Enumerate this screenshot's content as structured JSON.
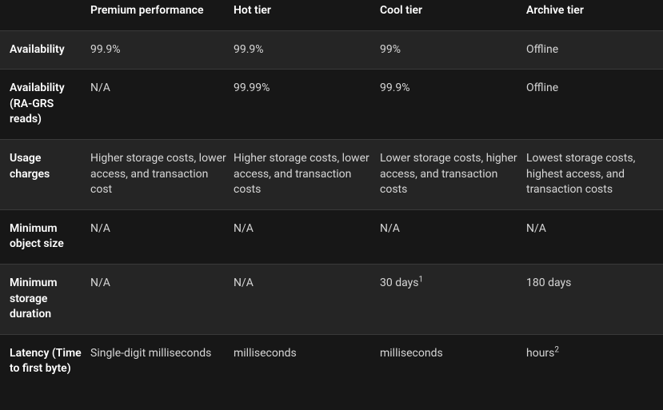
{
  "headers": {
    "label": "",
    "premium": "Premium performance",
    "hot": "Hot tier",
    "cool": "Cool tier",
    "archive": "Archive tier"
  },
  "rows": {
    "availability": {
      "label": "Availability",
      "premium": "99.9%",
      "hot": "99.9%",
      "cool": "99%",
      "archive": "Offline"
    },
    "availability_ragrs": {
      "label": "Availability (RA-GRS reads)",
      "premium": "N/A",
      "hot": "99.99%",
      "cool": "99.9%",
      "archive": "Offline"
    },
    "usage_charges": {
      "label": "Usage charges",
      "premium": "Higher storage costs, lower access, and transaction cost",
      "hot": "Higher storage costs, lower access, and transaction costs",
      "cool": "Lower storage costs, higher access, and transaction costs",
      "archive": "Lowest storage costs, highest access, and transaction costs"
    },
    "min_object_size": {
      "label": "Minimum object size",
      "premium": "N/A",
      "hot": "N/A",
      "cool": "N/A",
      "archive": "N/A"
    },
    "min_storage_duration": {
      "label": "Minimum storage duration",
      "premium": "N/A",
      "hot": "N/A",
      "cool": "30 days",
      "cool_sup": "1",
      "archive": "180 days"
    },
    "latency": {
      "label": "Latency (Time to first byte)",
      "premium": "Single-digit milliseconds",
      "hot": "milliseconds",
      "cool": "milliseconds",
      "archive": "hours",
      "archive_sup": "2"
    }
  }
}
